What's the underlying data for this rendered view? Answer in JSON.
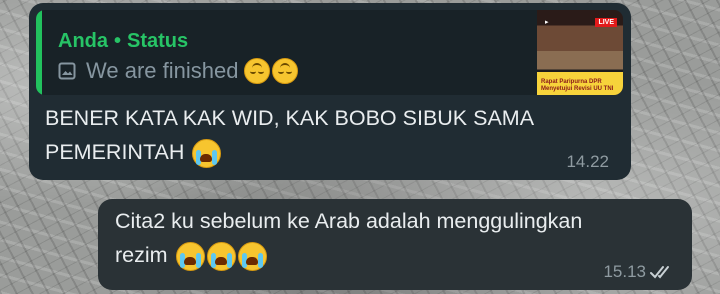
{
  "incoming_message": {
    "quote": {
      "author": "Anda",
      "separator": "•",
      "type": "Status",
      "text": "We are finished",
      "icon": "photo-icon",
      "thumbnail_caption": "Rapat Paripurna DPR Menyetujui Revisi UU TNI",
      "thumbnail_badge": "LIVE"
    },
    "text": "BENER KATA KAK WID, KAK BOBO SIBUK SAMA PEMERINTAH",
    "time": "14.22"
  },
  "outgoing_message": {
    "text": "Cita2 ku sebelum ke Arab adalah menggulingkan rezim",
    "time": "15.13",
    "status_icon": "double-check-read-icon"
  },
  "colors": {
    "incoming_bubble": "#202c33",
    "outgoing_bubble": "#2a3236",
    "accent_green": "#22c25e"
  }
}
